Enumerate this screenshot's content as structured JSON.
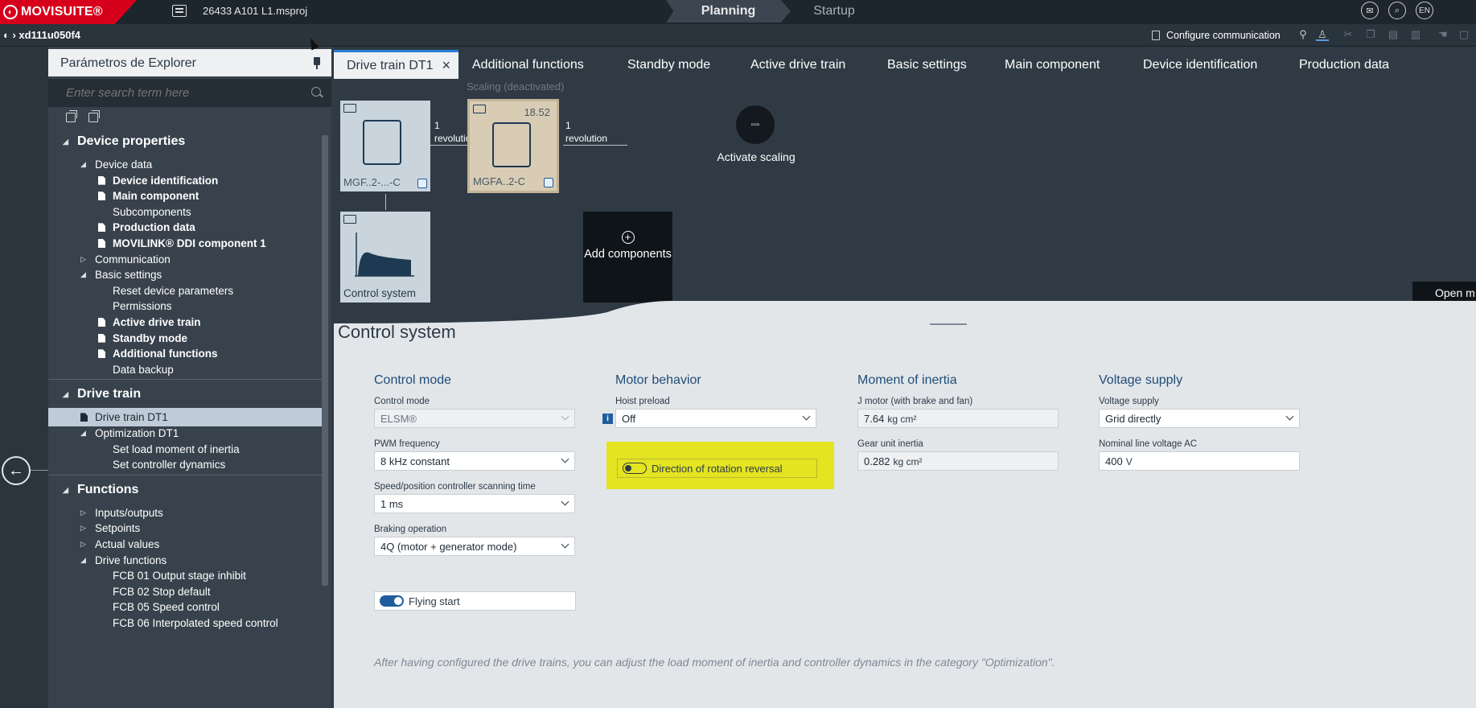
{
  "app": {
    "logo_text": "MOVISUITE®",
    "project": "26433 A101 L1.msproj"
  },
  "modes": {
    "planning": "Planning",
    "startup": "Startup"
  },
  "top_icons": [
    "mail-icon",
    "search-icon",
    "language-icon"
  ],
  "language": "EN",
  "device_crumb": "xd111u050f4",
  "toolbar": {
    "configure_label": "Configure communication"
  },
  "explorer": {
    "title": "Parámetros de Explorer",
    "search_placeholder": "Enter search term here",
    "tree": [
      {
        "label": "Device properties",
        "level": 0,
        "kind": "section",
        "expanded": true
      },
      {
        "label": "Device data",
        "level": 1,
        "kind": "group",
        "expanded": true
      },
      {
        "label": "Device identification",
        "level": 2,
        "kind": "doc",
        "bold": true
      },
      {
        "label": "Main component",
        "level": 2,
        "kind": "doc",
        "bold": true
      },
      {
        "label": "Subcomponents",
        "level": 2,
        "kind": "plain"
      },
      {
        "label": "Production data",
        "level": 2,
        "kind": "doc",
        "bold": true
      },
      {
        "label": "MOVILINK® DDI component 1",
        "level": 2,
        "kind": "doc",
        "bold": true
      },
      {
        "label": "Communication",
        "level": 1,
        "kind": "group",
        "expanded": false
      },
      {
        "label": "Basic settings",
        "level": 1,
        "kind": "group",
        "expanded": true
      },
      {
        "label": "Reset device parameters",
        "level": 2,
        "kind": "plain"
      },
      {
        "label": "Permissions",
        "level": 2,
        "kind": "plain"
      },
      {
        "label": "Active drive train",
        "level": 2,
        "kind": "doc",
        "bold": true
      },
      {
        "label": "Standby mode",
        "level": 2,
        "kind": "doc",
        "bold": true
      },
      {
        "label": "Additional functions",
        "level": 2,
        "kind": "doc",
        "bold": true
      },
      {
        "label": "Data backup",
        "level": 2,
        "kind": "plain"
      },
      {
        "label": "Drive train",
        "level": 0,
        "kind": "section",
        "expanded": true
      },
      {
        "label": "Drive train DT1",
        "level": 1,
        "kind": "doc",
        "selected": true
      },
      {
        "label": "Optimization DT1",
        "level": 1,
        "kind": "group",
        "expanded": true
      },
      {
        "label": "Set load moment of inertia",
        "level": 2,
        "kind": "plain"
      },
      {
        "label": "Set controller dynamics",
        "level": 2,
        "kind": "plain"
      },
      {
        "label": "Functions",
        "level": 0,
        "kind": "section",
        "expanded": true
      },
      {
        "label": "Inputs/outputs",
        "level": 1,
        "kind": "group",
        "expanded": false
      },
      {
        "label": "Setpoints",
        "level": 1,
        "kind": "group",
        "expanded": false
      },
      {
        "label": "Actual values",
        "level": 1,
        "kind": "group",
        "expanded": false
      },
      {
        "label": "Drive functions",
        "level": 1,
        "kind": "group",
        "expanded": true
      },
      {
        "label": "FCB 01 Output stage inhibit",
        "level": 2,
        "kind": "plain"
      },
      {
        "label": "FCB 02 Stop default",
        "level": 2,
        "kind": "plain"
      },
      {
        "label": "FCB 05 Speed control",
        "level": 2,
        "kind": "plain"
      },
      {
        "label": "FCB 06 Interpolated speed control",
        "level": 2,
        "kind": "plain"
      }
    ]
  },
  "tabs": [
    "Drive train DT1",
    "Additional functions",
    "Standby mode",
    "Active drive train",
    "Basic settings",
    "Main component",
    "Device identification",
    "Production data"
  ],
  "diagram": {
    "motor_label": "MGF..2-...-C",
    "gear_label": "MGFA..2-C",
    "gear_ratio": "18.52",
    "scaling_label": "Scaling (deactivated)",
    "conn1": "1 revolution",
    "conn2": "1 revolution",
    "control_label": "Control system",
    "activate_scaling": "Activate scaling",
    "add_components": "Add components",
    "open_more": "Open m"
  },
  "panel": {
    "title": "Control system",
    "control_mode": {
      "heading": "Control mode",
      "control_mode_label": "Control mode",
      "control_mode_value": "ELSM®",
      "pwm_label": "PWM frequency",
      "pwm_value": "8 kHz constant",
      "scan_label": "Speed/position controller scanning time",
      "scan_value": "1 ms",
      "braking_label": "Braking operation",
      "braking_value": "4Q (motor + generator mode)",
      "flying_start": "Flying start",
      "flying_start_on": true
    },
    "motor_behavior": {
      "heading": "Motor behavior",
      "hoist_label": "Hoist preload",
      "hoist_value": "Off",
      "rotation_reversal": "Direction of rotation reversal",
      "rotation_reversal_on": false
    },
    "inertia": {
      "heading": "Moment of inertia",
      "jmotor_label": "J motor (with brake and fan)",
      "jmotor_value": "7.64",
      "jmotor_unit": "kg cm²",
      "gear_label": "Gear unit inertia",
      "gear_value": "0.282",
      "gear_unit": "kg cm²"
    },
    "voltage": {
      "heading": "Voltage supply",
      "supply_label": "Voltage supply",
      "supply_value": "Grid directly",
      "line_label": "Nominal line voltage AC",
      "line_value": "400",
      "line_unit": "V"
    },
    "hint": "After having configured the drive trains, you can adjust the load moment of inertia and controller dynamics in the category \"Optimization\"."
  },
  "colors": {
    "brand": "#d6001c",
    "accent": "#1f5d9d",
    "highlight": "#e4e420"
  }
}
